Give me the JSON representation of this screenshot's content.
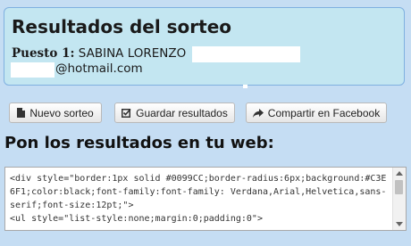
{
  "result_box": {
    "title": "Resultados del sorteo",
    "entries": [
      {
        "place_label": "Puesto 1:",
        "name": "SABINA LORENZO",
        "email_suffix": "@hotmail.com"
      }
    ]
  },
  "toolbar": {
    "new_draw_label": "Nuevo sorteo",
    "save_label": "Guardar resultados",
    "share_label": "Compartir en Facebook"
  },
  "embed": {
    "heading": "Pon los resultados en tu web:",
    "code": "<div style=\"border:1px solid #0099CC;border-radius:6px;background:#C3E6F1;color:black;font-family:font-family: Verdana,Arial,Helvetica,sans-serif;font-size:12pt;\">\n<ul style=\"list-style:none;margin:0;padding:0\">"
  },
  "colors": {
    "page_background": "#c5ddf3",
    "result_box_background": "#c3e6f1",
    "result_box_border": "#7fb0e0"
  },
  "icons": {
    "new_draw": "document-icon",
    "save": "edit-check-icon",
    "share": "share-arrow-icon"
  }
}
